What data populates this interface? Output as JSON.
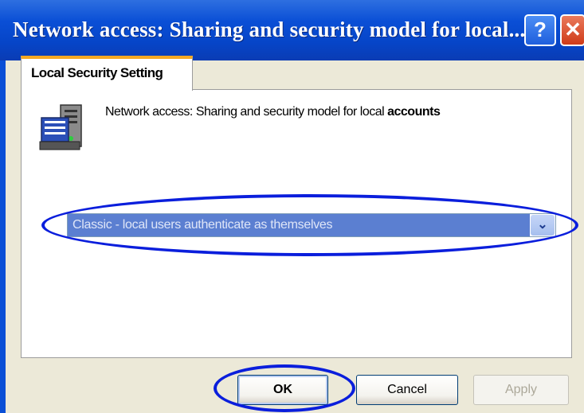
{
  "window": {
    "title": "Network access: Sharing and security model for local...",
    "help_symbol": "?",
    "close_symbol": "✕"
  },
  "tabs": [
    {
      "label": "Local Security Setting",
      "active": true
    }
  ],
  "policy": {
    "icon": "server-icon",
    "label_prefix": "Network access: Sharing and security model for local ",
    "label_suffix": "accounts"
  },
  "dropdown": {
    "selected": "Classic - local users authenticate as themselves",
    "arrow_symbol": "⌄"
  },
  "buttons": {
    "ok": "OK",
    "cancel": "Cancel",
    "apply": "Apply"
  },
  "colors": {
    "titlebar": "#0a4fd6",
    "highlight_ellipse": "#0a1edc",
    "dropdown_selection": "#5b7fd1",
    "tab_accent": "#f4a823"
  }
}
